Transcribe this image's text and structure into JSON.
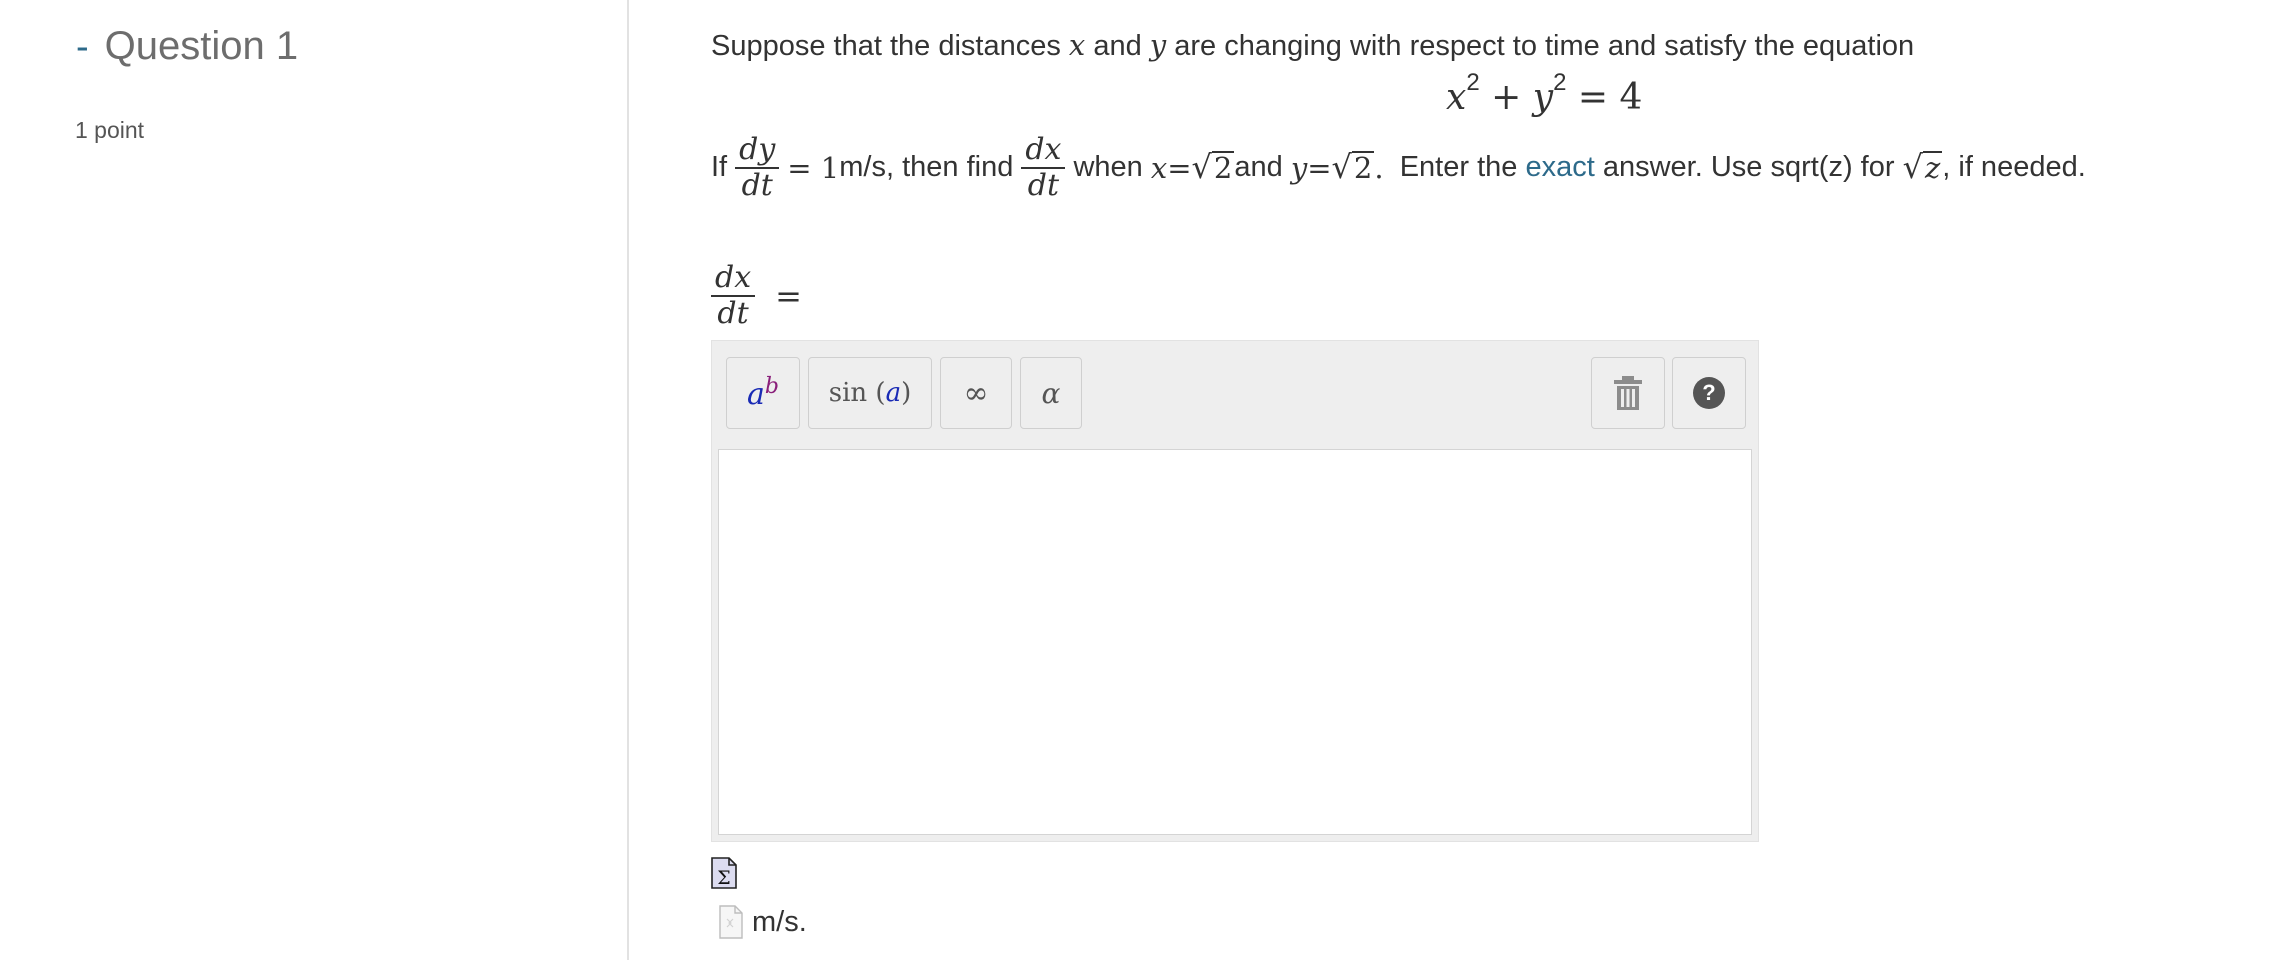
{
  "sidebar": {
    "collapse_toggle": "-",
    "question_title": "Question 1",
    "points": "1 point"
  },
  "prompt": {
    "intro_1": "Suppose that the distances ",
    "var_x": "x",
    "intro_2": " and ",
    "var_y": "y",
    "intro_3": " are changing with respect to time and satisfy the equation",
    "eq_x": "x",
    "eq_exp1": "2",
    "eq_plus": " + ",
    "eq_y": "y",
    "eq_exp2": "2",
    "eq_rhs": " = 4",
    "if": "If",
    "dy": "dy",
    "dt": "dt",
    "given_value": "= 1",
    "given_units": " m/s, then find",
    "dx": "dx",
    "when": " when ",
    "cond_x": "x",
    "cond_eq1": " =",
    "root_2a": "2",
    "and": " and ",
    "cond_y": "y",
    "cond_eq2": " =",
    "root_2b": "2",
    "period": ".",
    "enter_the": "  Enter the ",
    "exact_link": "exact",
    "instr_rest": " answer. Use sqrt(z) for ",
    "root_z": "z",
    "if_needed": ", if needed."
  },
  "answer": {
    "lhs_num": "dx",
    "lhs_den": "dt",
    "equals": "=",
    "value": "",
    "units": "m/s."
  },
  "toolbar": {
    "power_base": "a",
    "power_exp": "b",
    "func_name": "sin",
    "func_open": "(",
    "func_arg": "a",
    "func_close": ")",
    "infinity": "∞",
    "greek": "α",
    "help": "?"
  },
  "colors": {
    "accent": "#2d6a8a",
    "toolbar_bg": "#eeeeee",
    "symbol_blue": "#1a2bb5",
    "symbol_purple": "#8a1f7a"
  }
}
